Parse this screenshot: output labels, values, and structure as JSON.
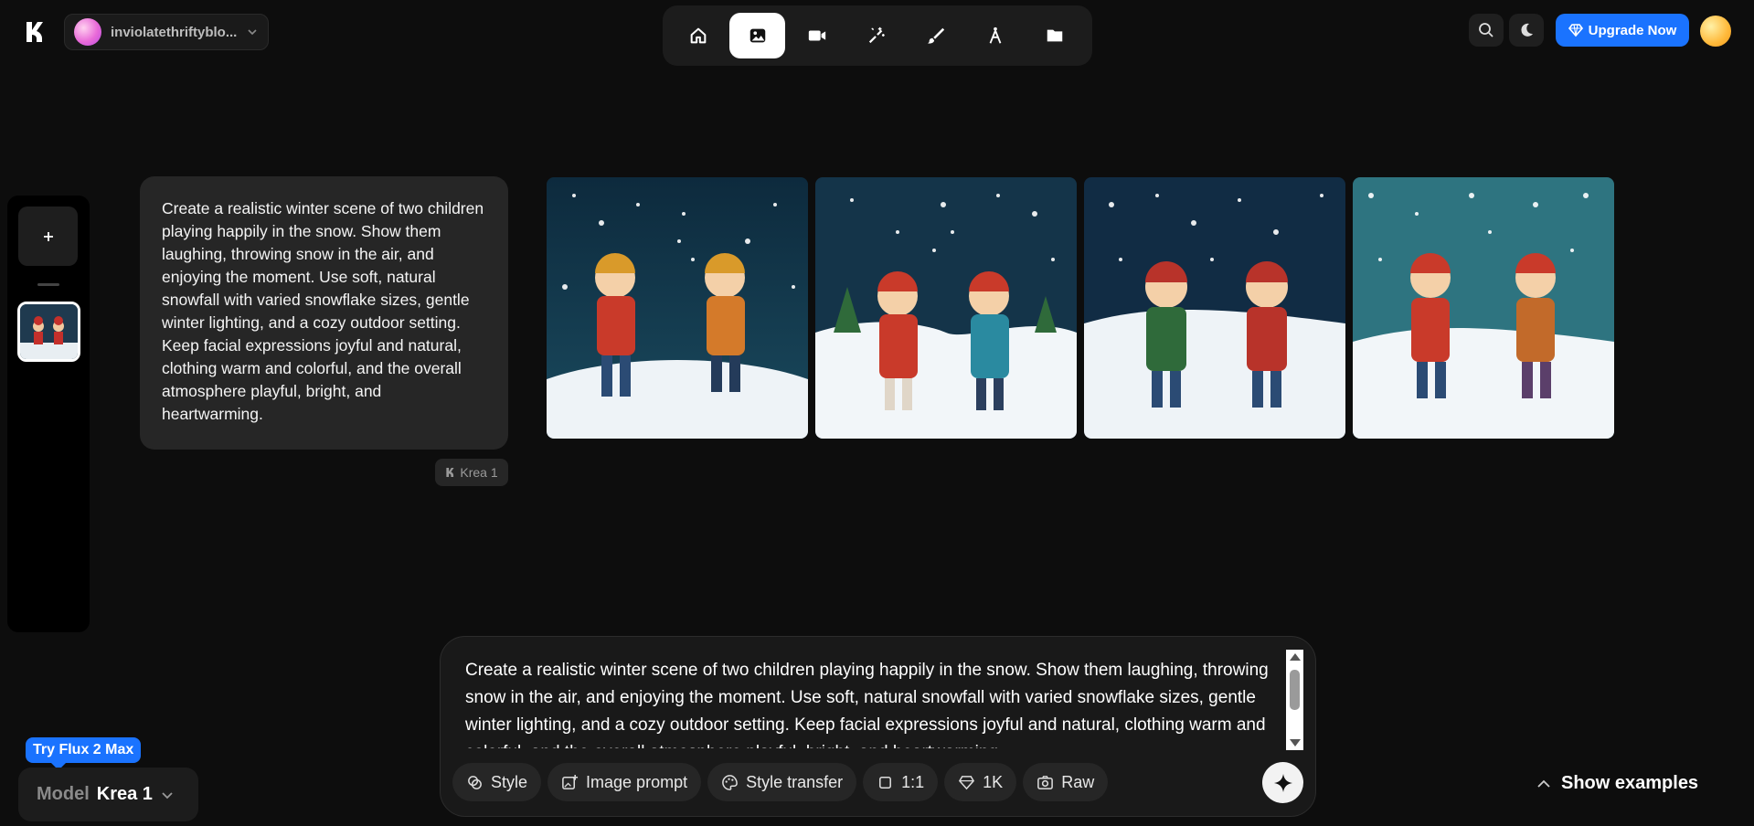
{
  "workspace": {
    "name": "inviolatethriftyblo..."
  },
  "toolbar": {
    "tools": [
      {
        "name": "home",
        "active": false
      },
      {
        "name": "image",
        "active": true
      },
      {
        "name": "video",
        "active": false
      },
      {
        "name": "enhance",
        "active": false
      },
      {
        "name": "edit",
        "active": false
      },
      {
        "name": "train",
        "active": false
      },
      {
        "name": "assets",
        "active": false
      }
    ]
  },
  "header": {
    "upgrade_label": "Upgrade Now"
  },
  "prompt_card": {
    "text": "Create a realistic winter scene of two children playing happily in the snow. Show them laughing, throwing snow in the air, and enjoying the moment. Use soft, natural snowfall with varied snowflake sizes, gentle winter lighting, and a cozy outdoor setting. Keep facial expressions joyful and natural, clothing warm and colorful, and the overall atmosphere playful, bright, and heartwarming.",
    "model_tag": "Krea 1"
  },
  "input": {
    "text": "Create a realistic winter scene of two children playing happily in the snow. Show them laughing, throwing snow in the air, and enjoying the moment. Use soft, natural snowfall with varied snowflake sizes, gentle winter lighting, and a cozy outdoor setting. Keep facial expressions joyful and natural, clothing warm and colorful, and the overall atmosphere playful, bright, and heartwarming."
  },
  "chips": {
    "style": "Style",
    "image_prompt": "Image prompt",
    "style_transfer": "Style transfer",
    "aspect": "1:1",
    "resolution": "1K",
    "raw": "Raw"
  },
  "model": {
    "badge": "Try Flux 2 Max",
    "label": "Model",
    "value": "Krea 1"
  },
  "show_examples": "Show examples",
  "colors": {
    "accent": "#1a73ff",
    "background": "#0d0d0d"
  }
}
